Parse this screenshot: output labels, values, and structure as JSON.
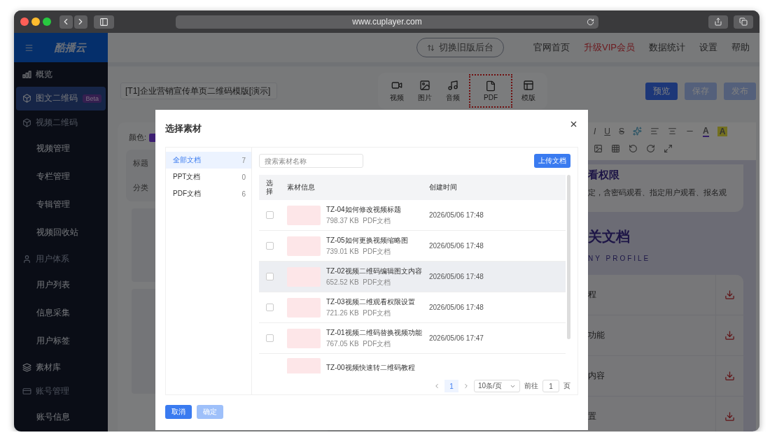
{
  "browser": {
    "url": "www.cuplayer.com"
  },
  "sidebar": {
    "brand": "酷播云",
    "items": [
      {
        "label": "概览",
        "kind": "link",
        "selected": false
      },
      {
        "label": "图文二维码",
        "kind": "link",
        "selected": true,
        "badge": "Beta"
      },
      {
        "label": "视频二维码",
        "kind": "group",
        "selected": false,
        "children": [
          {
            "label": "视频管理",
            "selected": false
          },
          {
            "label": "专栏管理",
            "selected": false
          },
          {
            "label": "专辑管理",
            "selected": false
          },
          {
            "label": "视频回收站",
            "selected": false
          }
        ]
      },
      {
        "label": "用户体系",
        "kind": "group",
        "selected": false,
        "children": [
          {
            "label": "用户列表",
            "selected": false
          },
          {
            "label": "信息采集",
            "selected": false
          },
          {
            "label": "用户标签",
            "selected": false
          }
        ]
      },
      {
        "label": "素材库",
        "kind": "link",
        "selected": false
      },
      {
        "label": "账号管理",
        "kind": "group",
        "selected": false,
        "children": [
          {
            "label": "账号信息",
            "selected": false
          }
        ]
      }
    ]
  },
  "header": {
    "switch_button": "切换旧版后台",
    "links": [
      {
        "label": "官网首页",
        "kind": "normal"
      },
      {
        "label": "升级VIP会员",
        "kind": "promo"
      },
      {
        "label": "数据统计",
        "kind": "normal"
      },
      {
        "label": "设置",
        "kind": "normal"
      },
      {
        "label": "帮助",
        "kind": "normal"
      }
    ]
  },
  "editor": {
    "title_value": "[T1]企业营销宣传单页二维码模版[演示]",
    "insert_tools": [
      {
        "label": "视频",
        "kind": "video",
        "highlighted": false
      },
      {
        "label": "图片",
        "kind": "image",
        "highlighted": false
      },
      {
        "label": "音频",
        "kind": "audio",
        "highlighted": false
      },
      {
        "label": "PDF",
        "kind": "pdf",
        "highlighted": true
      },
      {
        "label": "模版",
        "kind": "template",
        "highlighted": false
      }
    ],
    "actions": [
      {
        "label": "预览",
        "kind": "primary"
      },
      {
        "label": "保存",
        "kind": "secondary"
      },
      {
        "label": "发布",
        "kind": "secondary"
      }
    ],
    "settings": {
      "color_label": "颜色:",
      "fields": [
        "标题",
        "分类"
      ]
    },
    "format_row1": [
      {
        "kind": "italic",
        "label": "I"
      },
      {
        "kind": "underline",
        "label": "U"
      },
      {
        "kind": "strike",
        "label": "S"
      },
      {
        "kind": "sparkle"
      },
      {
        "kind": "align-left"
      },
      {
        "kind": "align-center"
      },
      {
        "kind": "rule"
      },
      {
        "kind": "font-color",
        "label": "A"
      },
      {
        "kind": "bg-color",
        "label": "A"
      }
    ],
    "format_row2": [
      {
        "kind": "image"
      },
      {
        "kind": "table"
      },
      {
        "kind": "undo"
      },
      {
        "kind": "redo"
      },
      {
        "kind": "expand"
      }
    ],
    "preview": {
      "section_title": "看权限",
      "section_text": "定，含密码观看、指定用户观看、报名观",
      "docs_heading": "关文档",
      "docs_subheading": "NY PROFILE",
      "docs": [
        "程",
        "功能",
        "内容",
        "置"
      ]
    }
  },
  "modal": {
    "title": "选择素材",
    "categories": [
      {
        "label": "全部文档",
        "count": "7",
        "selected": true
      },
      {
        "label": "PPT文档",
        "count": "0",
        "selected": false
      },
      {
        "label": "PDF文档",
        "count": "6",
        "selected": false
      }
    ],
    "search": {
      "placeholder": "搜索素材名称"
    },
    "upload_button": "上传文档",
    "columns": [
      "选择",
      "素材信息",
      "创建时间"
    ],
    "rows": [
      {
        "title": "TZ-04如何修改视频标题",
        "size": "798.37 KB",
        "type": "PDF文档",
        "date": "2026/05/06 17:48",
        "checked": false,
        "hovered": false
      },
      {
        "title": "TZ-05如何更换视频缩略图",
        "size": "739.01 KB",
        "type": "PDF文档",
        "date": "2026/05/06 17:48",
        "checked": false,
        "hovered": false
      },
      {
        "title": "TZ-02视频二维码编辑图文内容",
        "size": "652.52 KB",
        "type": "PDF文档",
        "date": "2026/05/06 17:48",
        "checked": false,
        "hovered": true
      },
      {
        "title": "TZ-03视频二维观看权限设置",
        "size": "721.26 KB",
        "type": "PDF文档",
        "date": "2026/05/06 17:48",
        "checked": false,
        "hovered": false
      },
      {
        "title": "TZ-01视频二维码替换视频功能",
        "size": "767.05 KB",
        "type": "PDF文档",
        "date": "2026/05/06 17:47",
        "checked": false,
        "hovered": false
      },
      {
        "title": "TZ-00视频快速转二维码教程",
        "hovered": false
      }
    ],
    "pagination": {
      "current": "1",
      "page_size": "10条/页",
      "goto_label": "前往",
      "goto_value": "1",
      "page_suffix": "页"
    },
    "buttons": [
      {
        "label": "取消",
        "disabled": false
      },
      {
        "label": "确定",
        "disabled": true
      }
    ]
  }
}
